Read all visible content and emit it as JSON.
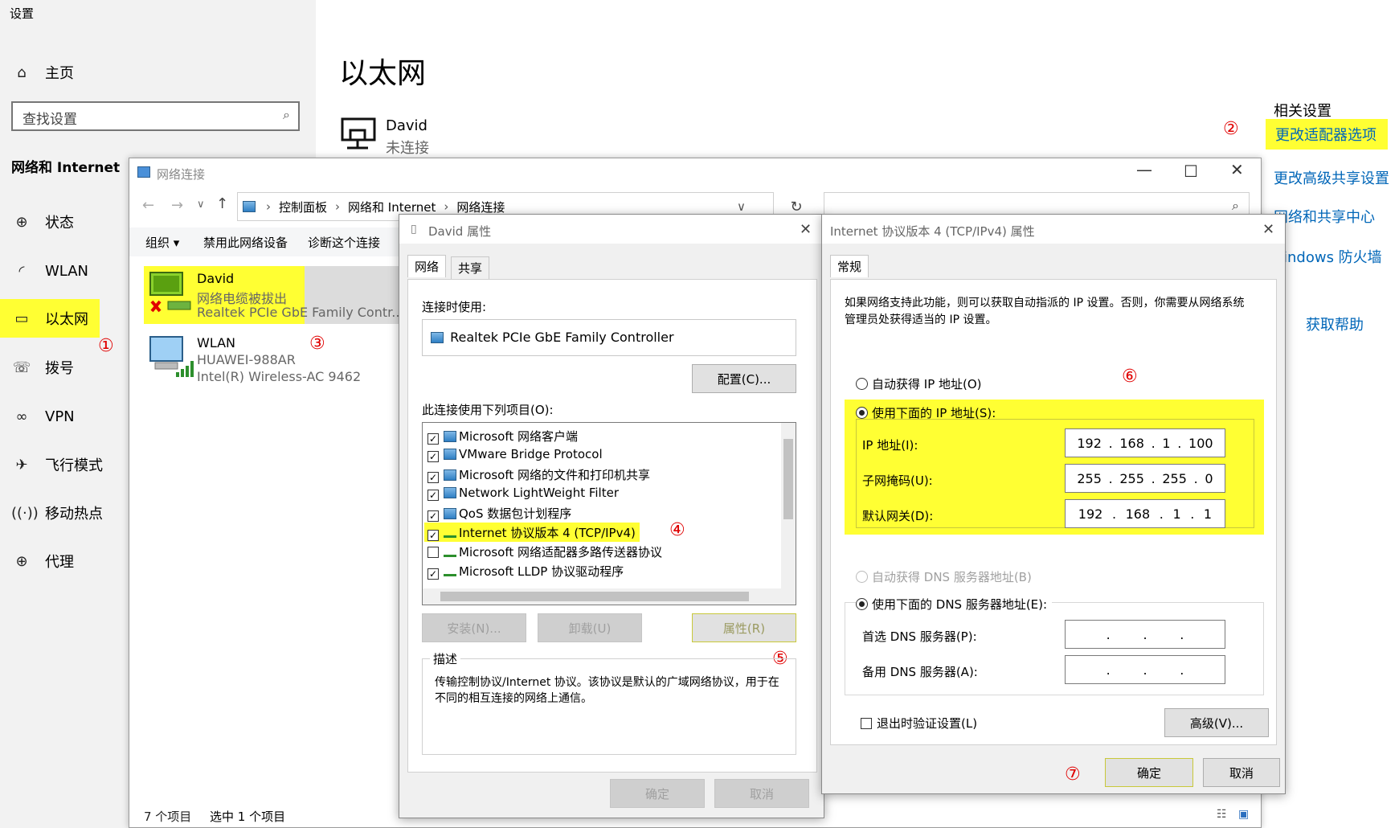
{
  "settings": {
    "app_title": "设置",
    "home_label": "主页",
    "search_placeholder": "查找设置",
    "section_title": "网络和 Internet",
    "nav_items": [
      {
        "label": "状态",
        "icon": "globe-icon"
      },
      {
        "label": "WLAN",
        "icon": "wifi-icon"
      },
      {
        "label": "以太网",
        "icon": "ethernet-icon"
      },
      {
        "label": "拨号",
        "icon": "dialup-icon"
      },
      {
        "label": "VPN",
        "icon": "vpn-icon"
      },
      {
        "label": "飞行模式",
        "icon": "airplane-icon"
      },
      {
        "label": "移动热点",
        "icon": "hotspot-icon"
      },
      {
        "label": "代理",
        "icon": "globe-icon"
      }
    ],
    "page_title": "以太网",
    "ethernet_name": "David",
    "ethernet_status": "未连接",
    "related_title": "相关设置",
    "related_links": [
      "更改适配器选项",
      "更改高级共享设置",
      "网络和共享中心",
      "indows 防火墙",
      "获取帮助"
    ],
    "highlight_color": "#ffff33",
    "link_color": "#0066b8"
  },
  "annotations": [
    "①",
    "②",
    "③",
    "④",
    "⑤",
    "⑥",
    "⑦"
  ],
  "network_connections": {
    "title": "网络连接",
    "breadcrumb": [
      "控制面板",
      "网络和 Internet",
      "网络连接"
    ],
    "toolbar": [
      "组织 ▾",
      "禁用此网络设备",
      "诊断这个连接"
    ],
    "items": [
      {
        "name": "David",
        "line2": "网络电缆被拔出",
        "line3": "Realtek PCIe GbE Family Contr..."
      },
      {
        "name": "WLAN",
        "line2": "HUAWEI-988AR",
        "line3": "Intel(R) Wireless-AC 9462"
      }
    ],
    "status_count": "7 个项目",
    "status_selected": "选中 1 个项目"
  },
  "props_dialog": {
    "title": "David 属性",
    "tabs": [
      "网络",
      "共享"
    ],
    "connect_using_label": "连接时使用:",
    "adapter_name": "Realtek PCIe GbE Family Controller",
    "configure_button": "配置(C)...",
    "items_label": "此连接使用下列项目(O):",
    "components": [
      {
        "label": "Microsoft 网络客户端",
        "checked": true
      },
      {
        "label": "VMware Bridge Protocol",
        "checked": true
      },
      {
        "label": "Microsoft 网络的文件和打印机共享",
        "checked": true
      },
      {
        "label": "Network LightWeight Filter",
        "checked": true
      },
      {
        "label": "QoS 数据包计划程序",
        "checked": true
      },
      {
        "label": "Internet 协议版本 4 (TCP/IPv4)",
        "checked": true
      },
      {
        "label": "Microsoft 网络适配器多路传送器协议",
        "checked": false
      },
      {
        "label": "Microsoft LLDP 协议驱动程序",
        "checked": true
      }
    ],
    "install_button": "安装(N)...",
    "uninstall_button": "卸载(U)",
    "properties_button": "属性(R)",
    "description_title": "描述",
    "description_text": "传输控制协议/Internet 协议。该协议是默认的广域网络协议，用于在不同的相互连接的网络上通信。",
    "ok_button": "确定",
    "cancel_button": "取消"
  },
  "ipv4_dialog": {
    "title": "Internet 协议版本 4 (TCP/IPv4) 属性",
    "tab": "常规",
    "intro": "如果网络支持此功能，则可以获取自动指派的 IP 设置。否则，你需要从网络系统管理员处获得适当的 IP 设置。",
    "auto_ip_label": "自动获得 IP 地址(O)",
    "manual_ip_label": "使用下面的 IP 地址(S):",
    "ip_label": "IP 地址(I):",
    "ip_value": [
      "192",
      "168",
      "1",
      "100"
    ],
    "mask_label": "子网掩码(U):",
    "mask_value": [
      "255",
      "255",
      "255",
      "0"
    ],
    "gateway_label": "默认网关(D):",
    "gateway_value": [
      "192",
      "168",
      "1",
      "1"
    ],
    "auto_dns_label": "自动获得 DNS 服务器地址(B)",
    "manual_dns_label": "使用下面的 DNS 服务器地址(E):",
    "dns1_label": "首选 DNS 服务器(P):",
    "dns2_label": "备用 DNS 服务器(A):",
    "validate_label": "退出时验证设置(L)",
    "advanced_button": "高级(V)...",
    "ok_button": "确定",
    "cancel_button": "取消"
  }
}
